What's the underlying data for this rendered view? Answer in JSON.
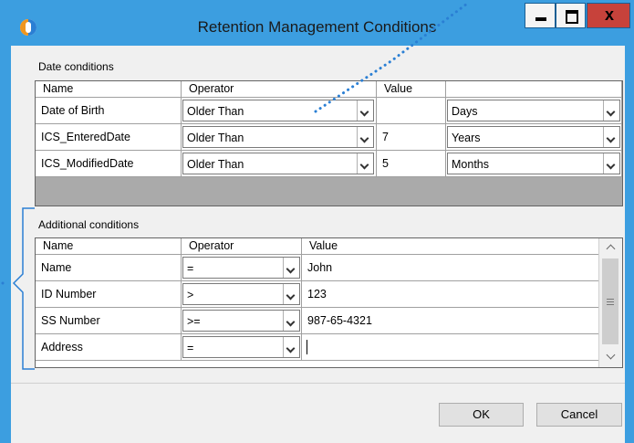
{
  "window": {
    "title": "Retention Management Conditions",
    "minimize_glyph": "_",
    "maximize_glyph": "□",
    "close_glyph": "x"
  },
  "date_conditions": {
    "label": "Date conditions",
    "headers": [
      "Name",
      "Operator",
      "Value",
      ""
    ],
    "rows": [
      {
        "name": "Date of Birth",
        "operator": "Older Than",
        "value": "",
        "unit": "Days"
      },
      {
        "name": "ICS_EnteredDate",
        "operator": "Older Than",
        "value": "7",
        "unit": "Years"
      },
      {
        "name": "ICS_ModifiedDate",
        "operator": "Older Than",
        "value": "5",
        "unit": "Months"
      }
    ]
  },
  "additional_conditions": {
    "label": "Additional conditions",
    "headers": [
      "Name",
      "Operator",
      "Value"
    ],
    "rows": [
      {
        "name": "Name",
        "operator": "=",
        "value": "John"
      },
      {
        "name": "ID Number",
        "operator": ">",
        "value": "123"
      },
      {
        "name": "SS Number",
        "operator": ">=",
        "value": "987-65-4321"
      },
      {
        "name": "Address",
        "operator": "=",
        "value": ""
      }
    ]
  },
  "buttons": {
    "ok": "OK",
    "cancel": "Cancel"
  },
  "colors": {
    "titlebar": "#3c9ee0",
    "close_button": "#c7423b",
    "annotation": "#2a7fd4"
  }
}
